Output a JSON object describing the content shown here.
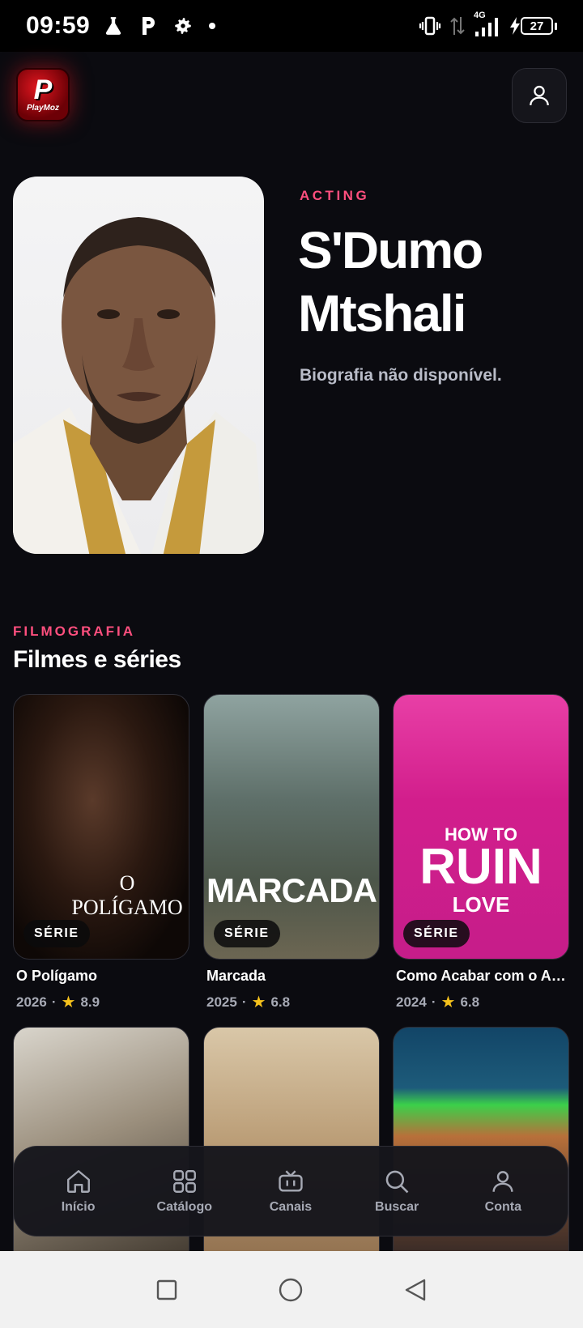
{
  "status_bar": {
    "time": "09:59",
    "network": "4G",
    "battery": "27"
  },
  "header": {
    "logo_text": "PlayMoz",
    "logo_letter": "P",
    "profile_icon": "user-icon"
  },
  "person": {
    "department": "ACTING",
    "name": "S'Dumo Mtshali",
    "bio": "Biografia não disponível."
  },
  "filmography": {
    "kicker": "FILMOGRAFIA",
    "title": "Filmes e séries",
    "items": [
      {
        "title": "O Polígamo",
        "year": "2026",
        "rating": "8.9",
        "badge": "SÉRIE",
        "poster_text": "O POLÍGAMO",
        "rating_icon": "star-icon"
      },
      {
        "title": "Marcada",
        "year": "2025",
        "rating": "6.8",
        "badge": "SÉRIE",
        "poster_text": "MARCADA",
        "rating_icon": "star-icon"
      },
      {
        "title": "Como Acabar com o Am...",
        "year": "2024",
        "rating": "6.8",
        "badge": "SÉRIE",
        "poster_text_1": "HOW TO",
        "poster_text_2": "RUIN",
        "poster_text_3": "LOVE",
        "rating_icon": "star-icon"
      }
    ]
  },
  "bottom_nav": {
    "items": [
      {
        "label": "Início",
        "icon": "home-icon"
      },
      {
        "label": "Catálogo",
        "icon": "grid-icon"
      },
      {
        "label": "Canais",
        "icon": "tv-icon"
      },
      {
        "label": "Buscar",
        "icon": "search-icon"
      },
      {
        "label": "Conta",
        "icon": "user-icon"
      }
    ]
  },
  "system_nav": {
    "items": [
      "recents-icon",
      "home-circle-icon",
      "back-icon"
    ]
  }
}
